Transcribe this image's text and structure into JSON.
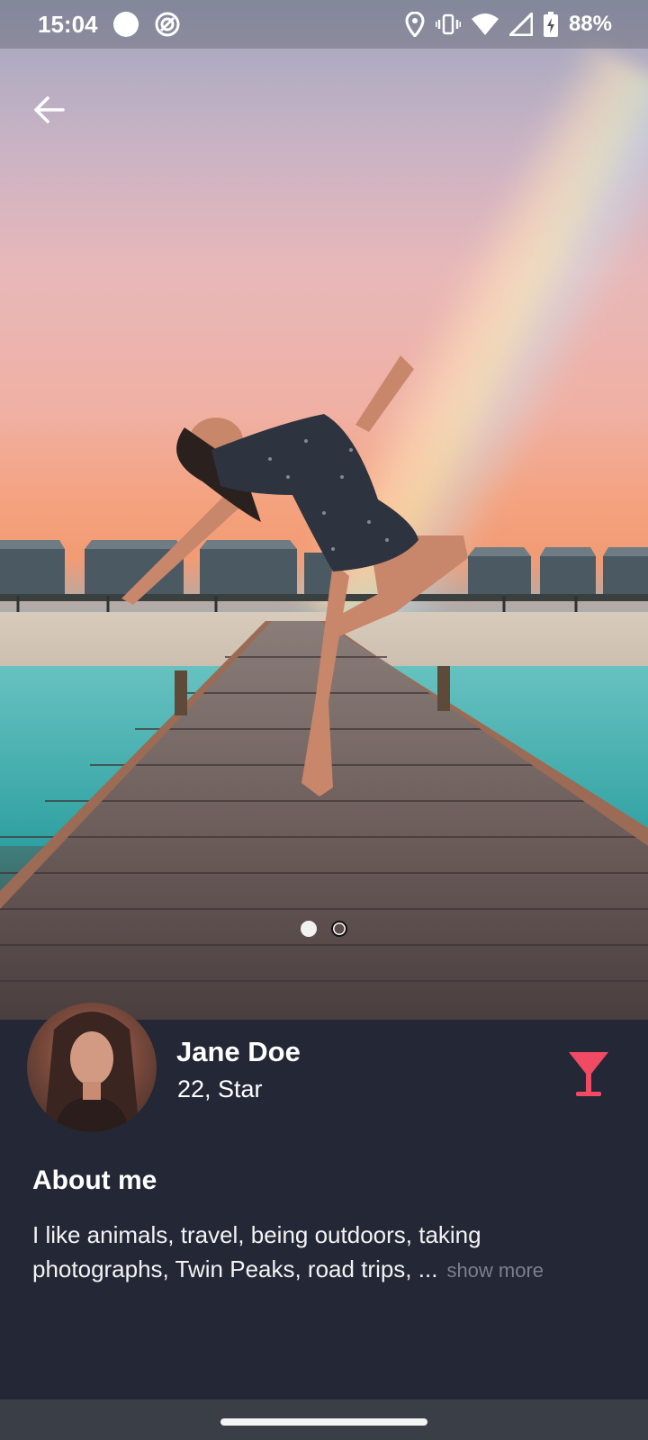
{
  "status_bar": {
    "time": "15:04",
    "battery_percent": "88%",
    "icons": [
      "circle-dot-icon",
      "sync-icon",
      "location-icon",
      "vibrate-icon",
      "wifi-icon",
      "signal-icon",
      "battery-charging-icon"
    ]
  },
  "gallery": {
    "photo_count": 2,
    "active_index": 0,
    "back_icon": "arrow-left-icon"
  },
  "profile": {
    "name": "Jane Doe",
    "subtitle": "22, Star",
    "badge_icon": "cocktail-icon",
    "accent_color": "#f04a64"
  },
  "about": {
    "title": "About me",
    "text": "I like animals, travel, being outdoors, taking photographs, Twin Peaks, road trips, ...",
    "show_more_label": "show more"
  }
}
